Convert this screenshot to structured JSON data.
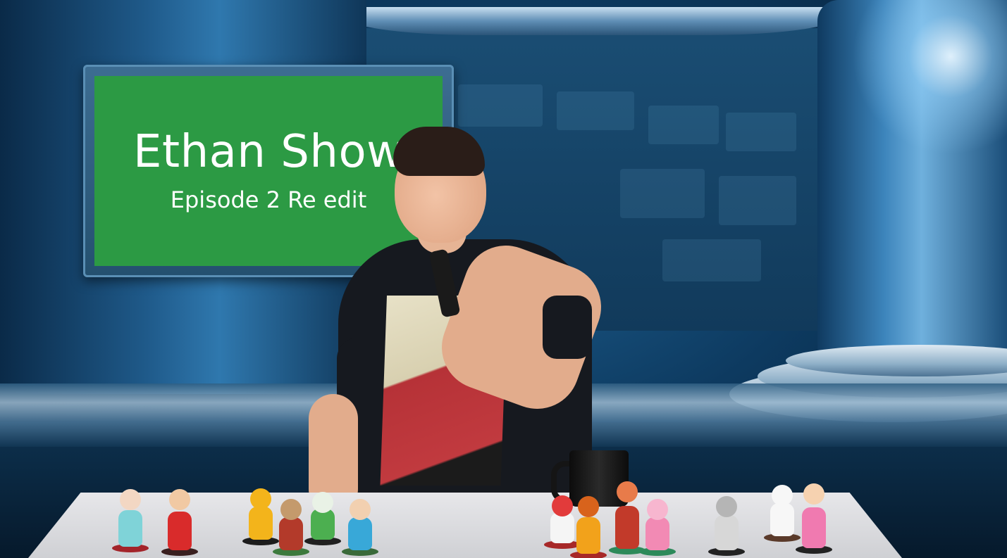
{
  "monitor": {
    "title": "Ethan Show",
    "subtitle": "Episode 2 Re edit"
  },
  "colors": {
    "screen_green": "#2c9a44",
    "studio_blue": "#1e5f8f",
    "text_white": "#ffffff"
  },
  "figures": [
    {
      "name": "rosalina-figure",
      "color": "#7fd3d8",
      "head": "#f3d7c3",
      "base": "#a3242a"
    },
    {
      "name": "mario-figure",
      "color": "#d92b2b",
      "head": "#f1c9a3",
      "base": "#3a1f1f"
    },
    {
      "name": "pacman-figure",
      "color": "#f3b41b",
      "head": "#f3b41b",
      "base": "#1c1c1c"
    },
    {
      "name": "dog-figure",
      "color": "#b33a2a",
      "head": "#c49a6c",
      "base": "#3d7a3d"
    },
    {
      "name": "yoshi-figure",
      "color": "#4caf50",
      "head": "#e9f2e6",
      "base": "#202020"
    },
    {
      "name": "villager-figure",
      "color": "#38a8d8",
      "head": "#f2d0b0",
      "base": "#3a6a3a"
    },
    {
      "name": "toad-figure",
      "color": "#f5f5f5",
      "head": "#e23b3b",
      "base": "#a72828"
    },
    {
      "name": "bowser-figure",
      "color": "#f2a21b",
      "head": "#d8631c",
      "base": "#a72828"
    },
    {
      "name": "8bit-mario-figure",
      "color": "#c23a2a",
      "head": "#e87b4a",
      "base": "#2d8a5a"
    },
    {
      "name": "pink-villager-figure",
      "color": "#f28ab4",
      "head": "#f7b6cf",
      "base": "#2d8a5a"
    },
    {
      "name": "robot-figure",
      "color": "#d7d7d7",
      "head": "#b5b5b5",
      "base": "#222222"
    },
    {
      "name": "kk-slider-figure",
      "color": "#f7f7f7",
      "head": "#f7f7f7",
      "base": "#5a3a2a"
    },
    {
      "name": "peach-figure",
      "color": "#f07ab0",
      "head": "#f6d2b0",
      "base": "#222222"
    }
  ]
}
